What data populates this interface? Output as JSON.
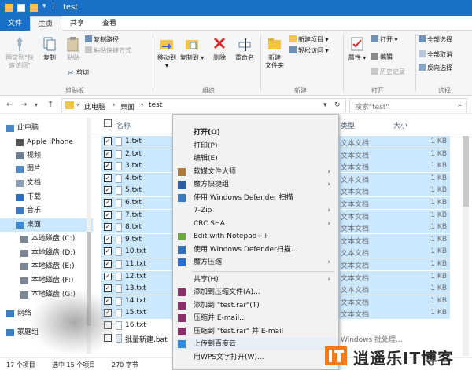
{
  "window": {
    "title": "test"
  },
  "ribbon_tabs": [
    "文件",
    "主页",
    "共享",
    "查看"
  ],
  "ribbon": {
    "clipboard": {
      "pin": "固定到\"快\n速访问\"",
      "copy": "复制",
      "paste": "粘贴",
      "copy_path": "复制路径",
      "paste_shortcut": "粘贴快捷方式",
      "cut": "剪切",
      "group": "剪贴板"
    },
    "organize": {
      "move_to": "移动到",
      "copy_to": "复制到",
      "delete": "删除",
      "rename": "重命名",
      "group": "组织"
    },
    "new": {
      "new_folder": "新建\n文件夹",
      "new_item": "新建项目",
      "easy_access": "轻松访问",
      "group": "新建"
    },
    "open": {
      "properties": "属性",
      "open": "打开",
      "edit": "编辑",
      "history": "历史记录",
      "group": "打开"
    },
    "select": {
      "select_all": "全部选择",
      "select_none": "全部取消",
      "invert": "反向选择",
      "group": "选择"
    }
  },
  "address": {
    "crumbs": [
      "此电脑",
      "桌面",
      "test"
    ],
    "search_placeholder": "搜索\"test\""
  },
  "nav": [
    {
      "label": "此电脑",
      "icon": "computer-icon"
    },
    {
      "label": "Apple iPhone",
      "icon": "phone-icon"
    },
    {
      "label": "视频",
      "icon": "video-folder-icon"
    },
    {
      "label": "图片",
      "icon": "picture-folder-icon"
    },
    {
      "label": "文档",
      "icon": "document-folder-icon"
    },
    {
      "label": "下载",
      "icon": "download-icon"
    },
    {
      "label": "音乐",
      "icon": "music-icon"
    },
    {
      "label": "桌面",
      "icon": "desktop-icon",
      "selected": true
    },
    {
      "label": "本地磁盘 (C:)",
      "icon": "drive-icon"
    },
    {
      "label": "本地磁盘 (D:)",
      "icon": "drive-icon"
    },
    {
      "label": "本地磁盘 (E:)",
      "icon": "drive-icon"
    },
    {
      "label": "本地磁盘 (F:)",
      "icon": "drive-icon"
    },
    {
      "label": "本地磁盘 (G:)",
      "icon": "drive-icon"
    },
    {
      "label": "网络",
      "icon": "network-icon"
    },
    {
      "label": "家庭组",
      "icon": "homegroup-icon"
    }
  ],
  "columns": {
    "name": "名称",
    "type": "类型",
    "size": "大小"
  },
  "files": [
    {
      "name": "1.txt",
      "type": "文本文档",
      "size": "1 KB",
      "selected": true
    },
    {
      "name": "2.txt",
      "type": "文本文档",
      "size": "1 KB",
      "selected": true
    },
    {
      "name": "3.txt",
      "type": "文本文档",
      "size": "1 KB",
      "selected": true
    },
    {
      "name": "4.txt",
      "type": "文本文档",
      "size": "1 KB",
      "selected": true
    },
    {
      "name": "5.txt",
      "type": "文本文档",
      "size": "1 KB",
      "selected": true
    },
    {
      "name": "6.txt",
      "type": "文本文档",
      "size": "1 KB",
      "selected": true
    },
    {
      "name": "7.txt",
      "type": "文本文档",
      "size": "1 KB",
      "selected": true
    },
    {
      "name": "8.txt",
      "type": "文本文档",
      "size": "1 KB",
      "selected": true
    },
    {
      "name": "9.txt",
      "type": "文本文档",
      "size": "1 KB",
      "selected": true
    },
    {
      "name": "10.txt",
      "type": "文本文档",
      "size": "1 KB",
      "selected": true
    },
    {
      "name": "11.txt",
      "type": "文本文档",
      "size": "1 KB",
      "selected": true
    },
    {
      "name": "12.txt",
      "type": "文本文档",
      "size": "1 KB",
      "selected": true
    },
    {
      "name": "13.txt",
      "type": "文本文档",
      "size": "1 KB",
      "selected": true
    },
    {
      "name": "14.txt",
      "type": "文本文档",
      "size": "1 KB",
      "selected": true
    },
    {
      "name": "15.txt",
      "type": "文本文档",
      "size": "1 KB",
      "selected": true
    },
    {
      "name": "16.txt",
      "type": "",
      "size": "",
      "selected": false
    },
    {
      "name": "批量新建.bat",
      "type": "Windows 批处理...",
      "size": "",
      "selected": false
    }
  ],
  "menu": [
    {
      "label": "打开(O)",
      "bold": true
    },
    {
      "label": "打印(P)"
    },
    {
      "label": "编辑(E)"
    },
    {
      "label": "软媒文件大师",
      "icon": "ruanmei-icon",
      "arrow": true
    },
    {
      "label": "魔方快捷组",
      "icon": "mofang-grid-icon",
      "arrow": true
    },
    {
      "label": "使用 Windows Defender 扫描",
      "icon": "defender-icon"
    },
    {
      "label": "7-Zip",
      "arrow": true
    },
    {
      "label": "CRC SHA",
      "arrow": true
    },
    {
      "label": "Edit with Notepad++",
      "icon": "notepad-plus-icon"
    },
    {
      "label": "使用 Windows Defender扫描...",
      "icon": "defender-shield-icon"
    },
    {
      "label": "魔方压缩",
      "icon": "mofang-compress-icon",
      "arrow": true
    },
    {
      "sep": true
    },
    {
      "label": "共享(H)",
      "arrow": true
    },
    {
      "label": "添加到压缩文件(A)...",
      "icon": "winrar-icon"
    },
    {
      "label": "添加到 \"test.rar\"(T)",
      "icon": "winrar-icon"
    },
    {
      "label": "压缩并 E-mail...",
      "icon": "winrar-icon"
    },
    {
      "label": "压缩到 \"test.rar\" 并 E-mail",
      "icon": "winrar-icon"
    },
    {
      "label": "上传到百度云",
      "icon": "baidu-cloud-icon",
      "highlight": true
    },
    {
      "label": "用WPS文字打开(W)..."
    }
  ],
  "status": {
    "items": "17 个项目",
    "selected": "选中 15 个项目",
    "bytes": "270 字节"
  },
  "watermark": {
    "text": "逍遥乐IT博客"
  }
}
